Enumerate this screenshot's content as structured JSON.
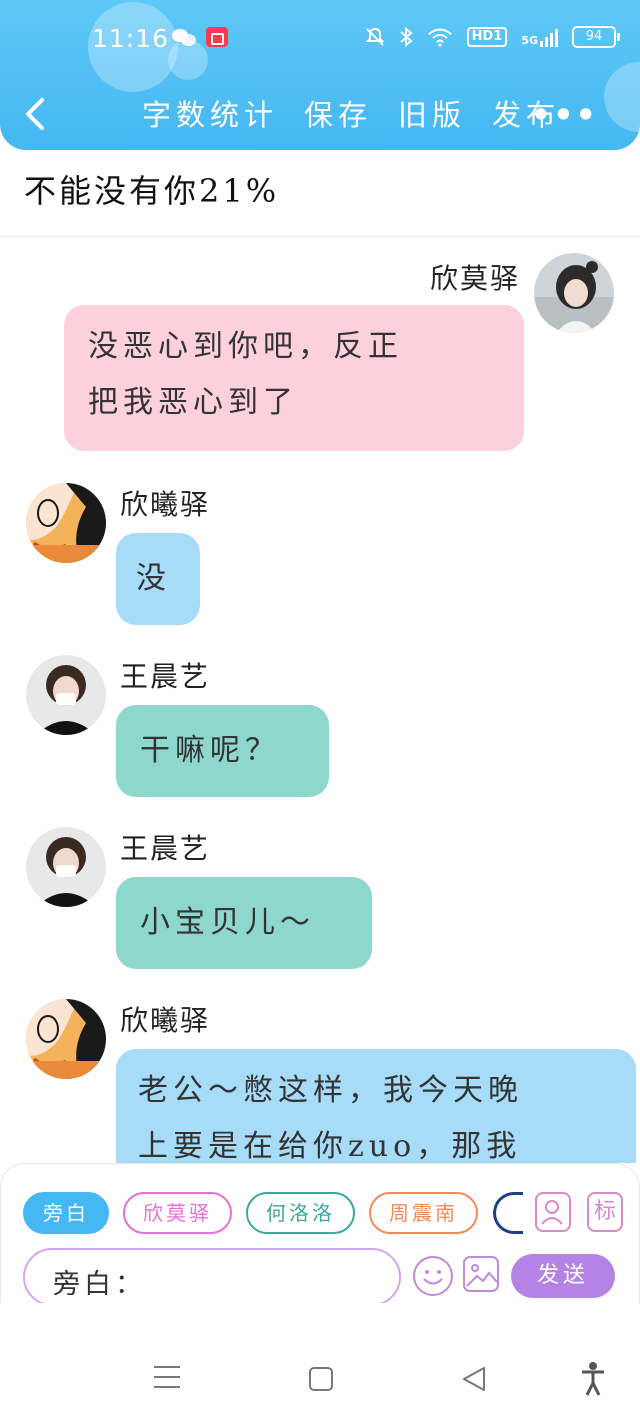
{
  "status_bar": {
    "time": "11:16",
    "network_badge": "HD1",
    "network_type": "5G",
    "battery": "94"
  },
  "header": {
    "actions": [
      "字数统计",
      "保存",
      "旧版",
      "发布"
    ],
    "more": "•••"
  },
  "story": {
    "title": "不能没有你21%"
  },
  "messages": [
    {
      "speaker": "欣莫驿",
      "text": "没恶心到你吧，反正把我恶心到了",
      "line1": "没恶心到你吧，反正",
      "line2": "把我恶心到了",
      "bubble_color": "#fdd0dd",
      "side": "right"
    },
    {
      "speaker": "欣曦驿",
      "text": "没",
      "bubble_color": "#a6dcf8",
      "side": "left"
    },
    {
      "speaker": "王晨艺",
      "text": "干嘛呢？",
      "bubble_color": "#8ed7cc",
      "side": "left"
    },
    {
      "speaker": "王晨艺",
      "text": "小宝贝儿～",
      "bubble_color": "#8ed7cc",
      "side": "left"
    },
    {
      "speaker": "欣曦驿",
      "text": "老公～憋这样，我今天晚上要是在给你zuo，那我",
      "line1": "老公～憋这样，我今天晚",
      "line2": "上要是在给你zuo，那我",
      "bubble_color": "#a6dcf8",
      "side": "left"
    }
  ],
  "composer": {
    "roles": [
      "旁白",
      "欣莫驿",
      "何洛洛",
      "周震南"
    ],
    "active_role": "旁白",
    "tool_biao": "标",
    "input_prefix": "旁白：",
    "input_value": "",
    "send_label": "发送"
  },
  "colors": {
    "header": "#45b7f2",
    "pink_bubble": "#fdd0dd",
    "blue_bubble": "#a6dcf8",
    "teal_bubble": "#8ed7cc",
    "send": "#b583e6"
  }
}
